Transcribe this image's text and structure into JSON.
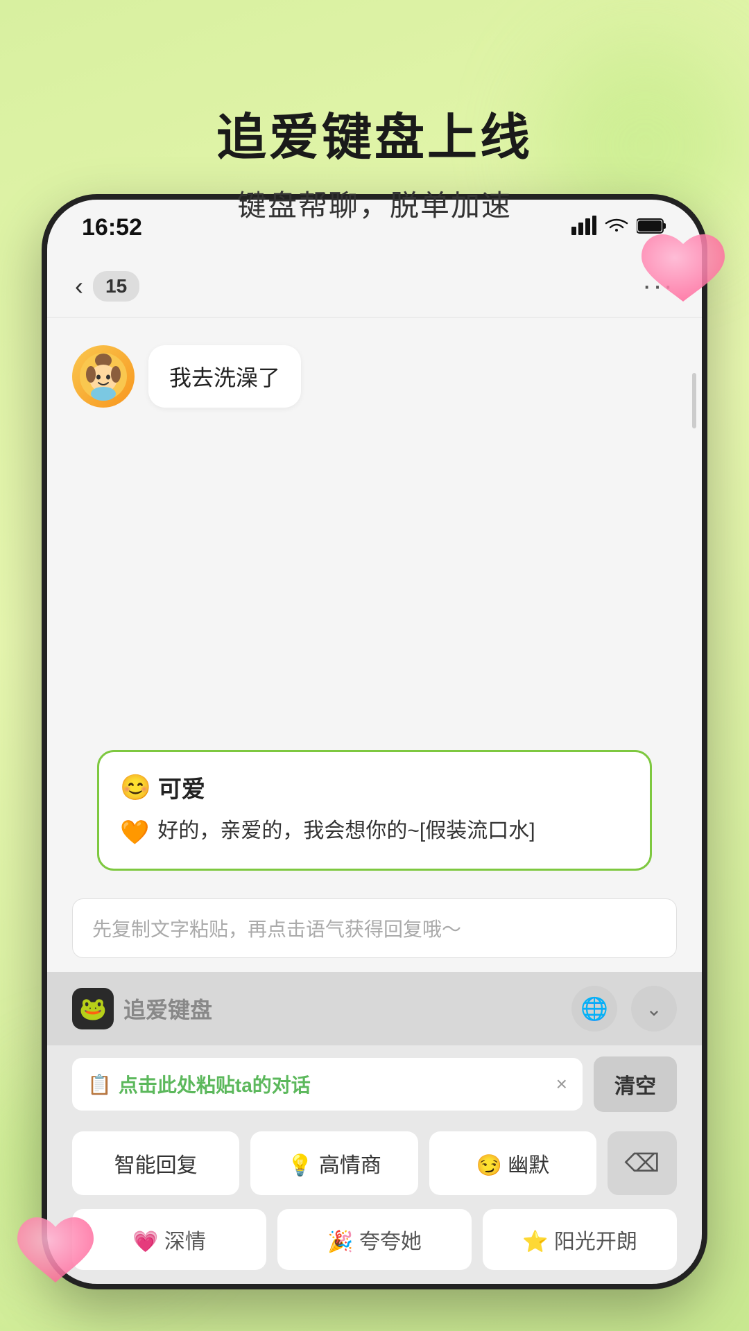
{
  "page": {
    "title": "追爱键盘上线",
    "subtitle": "键盘帮聊，脱单加速"
  },
  "status_bar": {
    "time": "16:52",
    "signal": "▲▲▲",
    "wifi": "WiFi",
    "battery": "Battery"
  },
  "chat_header": {
    "back_label": "15",
    "more_label": "···"
  },
  "messages": [
    {
      "avatar_emoji": "🧒",
      "text": "我去洗澡了"
    }
  ],
  "suggestion": {
    "title_emoji": "😊",
    "title": "可爱",
    "icon": "🧡",
    "body": "好的，亲爱的，我会想你的~[假装流口水]"
  },
  "input": {
    "placeholder": "先复制文字粘贴，再点击语气获得回复哦～"
  },
  "keyboard": {
    "logo_emoji": "🐸",
    "name": "追爱键盘",
    "globe_icon": "🌐",
    "expand_icon": "⌄"
  },
  "paste": {
    "icon": "📋",
    "text": "点击此处粘贴ta的对话",
    "close_icon": "×",
    "clear_label": "清空"
  },
  "quick_buttons_row1": [
    {
      "label": "智能回复",
      "emoji": ""
    },
    {
      "label": "高情商",
      "emoji": "💡"
    },
    {
      "label": "幽默",
      "emoji": "😏"
    }
  ],
  "quick_delete": "⌫",
  "quick_buttons_row2": [
    {
      "label": "深情",
      "emoji": "💗"
    },
    {
      "label": "夸夸她",
      "emoji": "🎉"
    },
    {
      "label": "阳光开朗",
      "emoji": "⭐"
    }
  ]
}
